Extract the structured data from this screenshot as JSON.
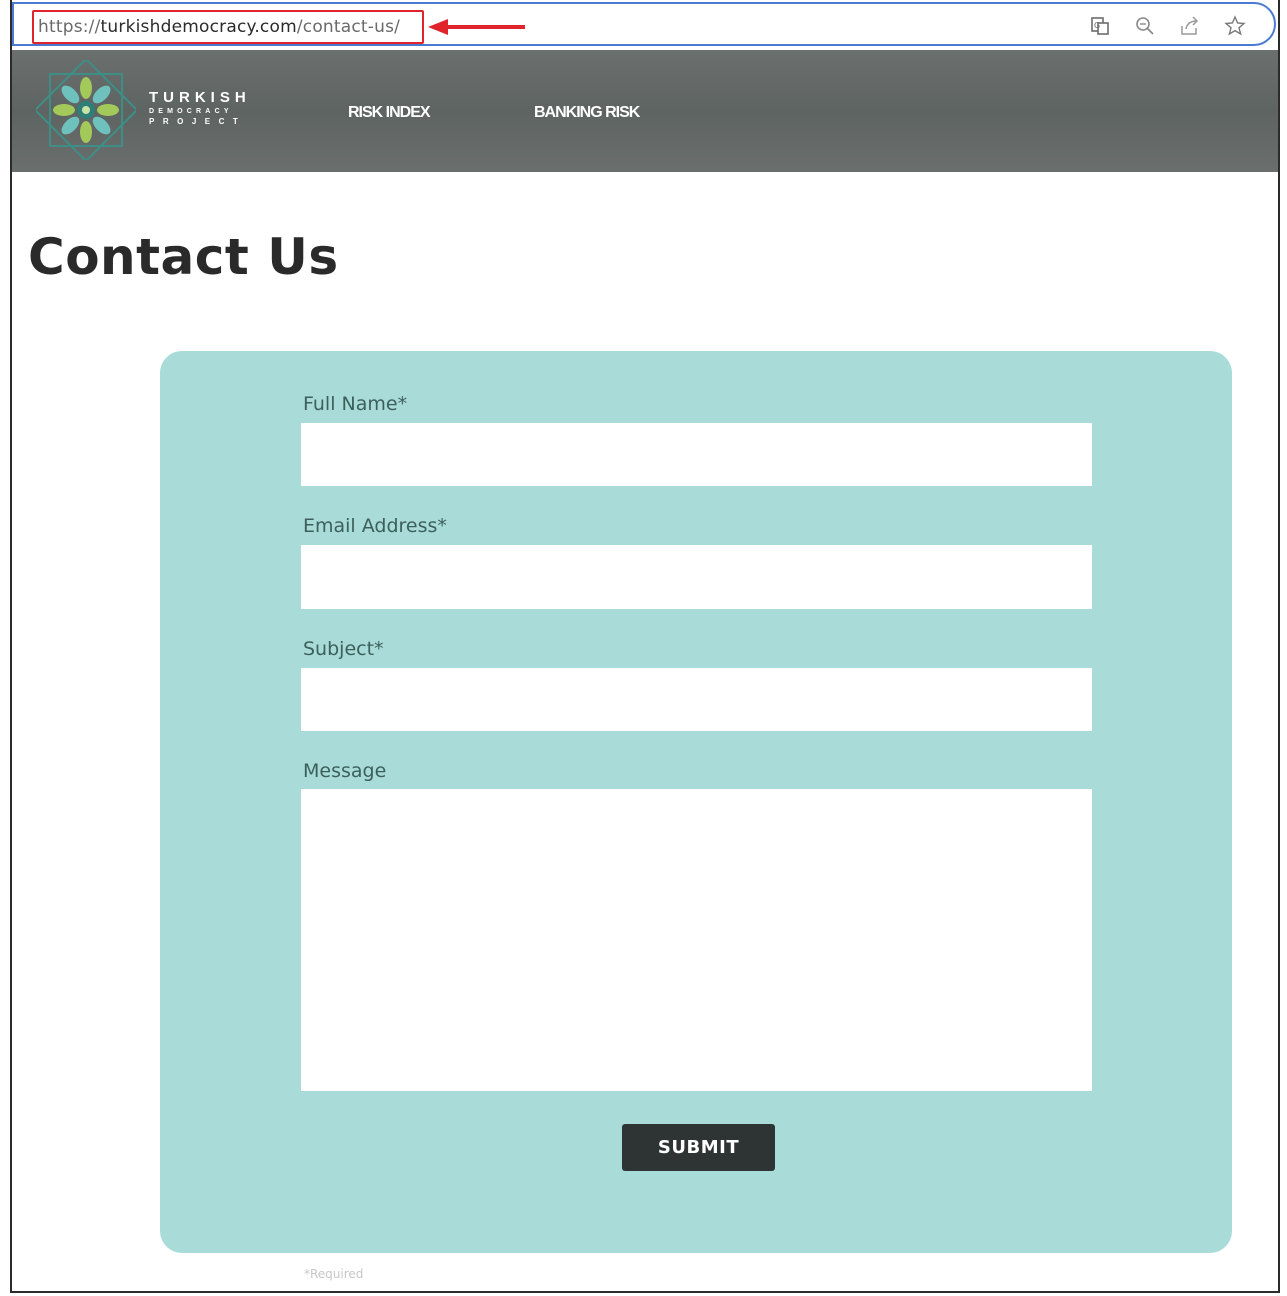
{
  "browser": {
    "url_scheme": "https://",
    "url_host": "turkishdemocracy.com",
    "url_path": "/contact-us/",
    "toolbar_icons": [
      "translate-icon",
      "zoom-icon",
      "share-icon",
      "bookmark-star-icon"
    ],
    "highlight_color": "#e0242c"
  },
  "header": {
    "logo": {
      "line1": "TURKISH",
      "line2": "DEMOCRACY",
      "line3": "PROJECT"
    },
    "nav": [
      {
        "label": "RISK INDEX"
      },
      {
        "label": "BANKING RISK"
      }
    ],
    "background_color": "#646a68"
  },
  "page": {
    "title": "Contact Us"
  },
  "form": {
    "panel_color": "#a9dcd8",
    "fields": [
      {
        "label": "Full Name*",
        "value": ""
      },
      {
        "label": "Email Address*",
        "value": ""
      },
      {
        "label": "Subject*",
        "value": ""
      },
      {
        "label": "Message",
        "value": ""
      }
    ],
    "submit_label": "SUBMIT",
    "required_note": "*Required"
  }
}
